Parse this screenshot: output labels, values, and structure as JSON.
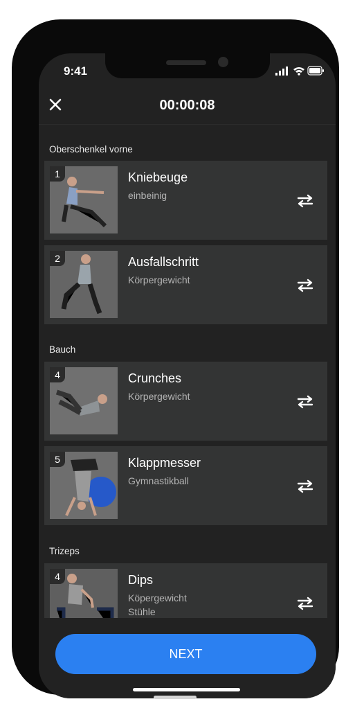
{
  "status_bar": {
    "time": "9:41"
  },
  "header": {
    "timer": "00:00:08"
  },
  "sections": [
    {
      "title": "Oberschenkel vorne"
    },
    {
      "title": "Bauch"
    },
    {
      "title": "Trizeps"
    }
  ],
  "exercises": [
    {
      "number": "1",
      "name": "Kniebeuge",
      "detail": "einbeinig"
    },
    {
      "number": "2",
      "name": "Ausfallschritt",
      "detail": "Körpergewicht"
    },
    {
      "number": "4",
      "name": "Crunches",
      "detail": "Körpergewicht"
    },
    {
      "number": "5",
      "name": "Klappmesser",
      "detail": "Gymnastikball"
    },
    {
      "number": "4",
      "name": "Dips",
      "detail": "Köpergewicht",
      "detail2": "Stühle"
    }
  ],
  "footer": {
    "next_label": "NEXT"
  },
  "colors": {
    "accent": "#2b80f1",
    "background": "#222222",
    "card": "#333434"
  }
}
